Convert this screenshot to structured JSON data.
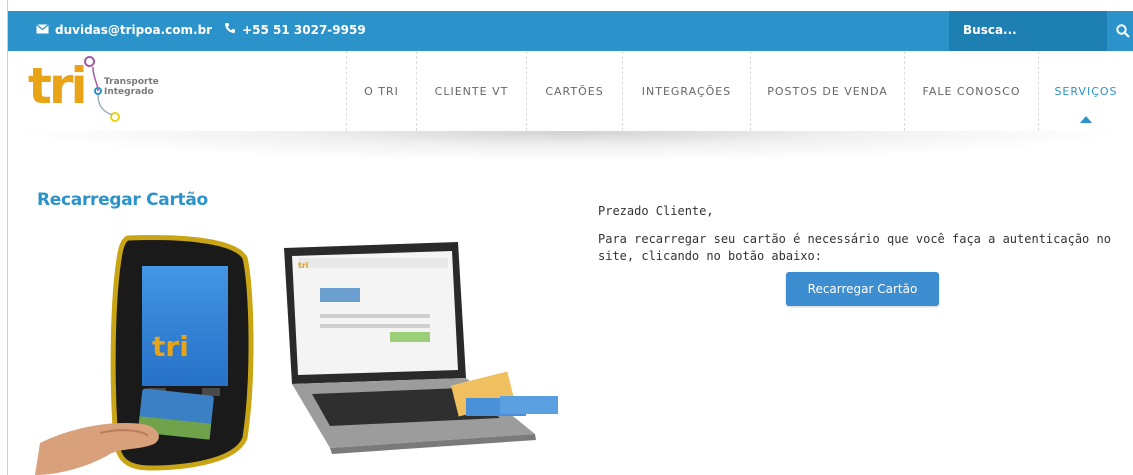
{
  "topbar": {
    "email": "duvidas@tripoa.com.br",
    "phone": "+55 51 3027-9959",
    "search_placeholder": "Busca..."
  },
  "logo": {
    "brand": "tri",
    "tagline_line1": "Transporte",
    "tagline_line2": "Integrado"
  },
  "nav": {
    "items": [
      {
        "label": "O TRI"
      },
      {
        "label": "CLIENTE VT"
      },
      {
        "label": "CARTÕES"
      },
      {
        "label": "INTEGRAÇÕES"
      },
      {
        "label": "POSTOS DE VENDA"
      },
      {
        "label": "FALE CONOSCO"
      },
      {
        "label": "SERVIÇOS",
        "active": true
      }
    ]
  },
  "main": {
    "title": "Recarregar Cartão",
    "greeting": "Prezado Cliente,",
    "message": "Para recarregar seu cartão é necessário que você faça a autenticação no site, clicando no botão abaixo:",
    "button_label": "Recarregar Cartão"
  },
  "colors": {
    "accent": "#2b93c9",
    "button": "#3d8ed0",
    "logo_orange": "#e8a317"
  },
  "icons": [
    "envelope-icon",
    "phone-icon",
    "search-icon",
    "caret-up-icon"
  ]
}
